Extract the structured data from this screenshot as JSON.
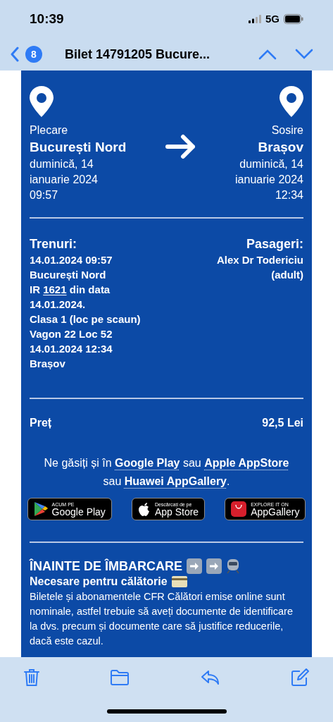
{
  "status_bar": {
    "time": "10:39",
    "network": "5G"
  },
  "nav_bar": {
    "badge": "8",
    "title": "Bilet 14791205 Bucure..."
  },
  "journey": {
    "departure": {
      "label": "Plecare",
      "station": "București Nord",
      "date_lines": [
        "duminică, 14",
        "ianuarie 2024",
        "09:57"
      ]
    },
    "arrival": {
      "label": "Sosire",
      "station": "Brașov",
      "date_lines": [
        "duminică, 14",
        "ianuarie 2024",
        "12:34"
      ]
    }
  },
  "trains": {
    "heading": "Trenuri:",
    "lines": [
      [
        {
          "kind": "text",
          "text": "14.01.2024 09:57"
        }
      ],
      [
        {
          "kind": "text",
          "text": "București Nord"
        }
      ],
      [
        {
          "kind": "text",
          "text": "IR "
        },
        {
          "kind": "link",
          "text": "1621"
        },
        {
          "kind": "text",
          "text": " din data"
        }
      ],
      [
        {
          "kind": "text",
          "text": "14.01.2024."
        }
      ],
      [
        {
          "kind": "text",
          "text": "Clasa 1 (loc pe scaun)"
        }
      ],
      [
        {
          "kind": "text",
          "text": "Vagon 22 Loc 52"
        }
      ],
      [
        {
          "kind": "text",
          "text": "14.01.2024 12:34"
        }
      ],
      [
        {
          "kind": "text",
          "text": "Brașov"
        }
      ]
    ]
  },
  "passengers": {
    "heading": "Pasageri:",
    "lines": [
      "Alex Dr Todericiu",
      "(adult)"
    ]
  },
  "price": {
    "label": "Preț",
    "value": "92,5 Lei"
  },
  "stores_note": [
    {
      "kind": "text",
      "text": "Ne găsiți și în "
    },
    {
      "kind": "link",
      "text": "Google Play"
    },
    {
      "kind": "text",
      "text": " sau "
    },
    {
      "kind": "link",
      "text": "Apple AppStore"
    },
    {
      "kind": "text",
      "text": " sau "
    },
    {
      "kind": "link",
      "text": "Huawei AppGallery"
    },
    {
      "kind": "text",
      "text": "."
    }
  ],
  "store_badges": [
    {
      "kind": "google",
      "small": "ACUM PE",
      "big": "Google Play"
    },
    {
      "kind": "apple",
      "small": "Descărcați de pe",
      "big": "App Store"
    },
    {
      "kind": "huawei",
      "small": "EXPLORE IT ON",
      "big": "AppGallery"
    }
  ],
  "boarding": {
    "heading": "ÎNAINTE DE ÎMBARCARE",
    "subheading": "Necesare pentru călătorie",
    "text": "Biletele și abonamentele CFR Călători emise online sunt nominale, astfel trebuie să aveți documente de identificare la dvs. precum și documente care să justifice reducerile, dacă este cazul."
  }
}
